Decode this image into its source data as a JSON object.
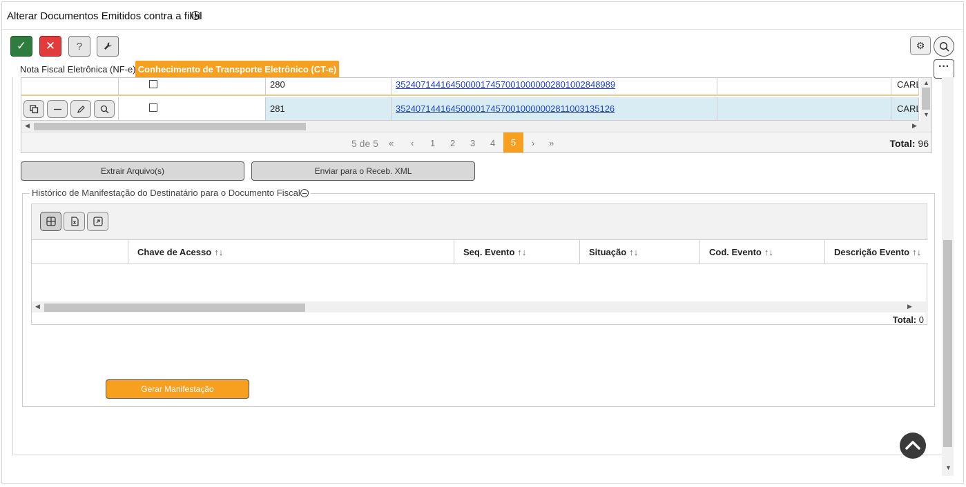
{
  "window": {
    "title": "Alterar Documentos Emitidos contra a filial"
  },
  "toolbar": {
    "confirm_label": "✓",
    "cancel_label": "✕",
    "help_label": "?"
  },
  "tabs": [
    {
      "label": "Nota Fiscal Eletrônica (NF-e)",
      "active": false
    },
    {
      "label": "Conhecimento de Transporte Eletrônico (CT-e)",
      "active": true
    }
  ],
  "documents_grid": {
    "rows": [
      {
        "number": "280",
        "key": "35240714416450000174570010000002801002848989",
        "name": "CARLO"
      },
      {
        "number": "281",
        "key": "35240714416450000174570010000002811003135126",
        "name": "CARLO"
      }
    ],
    "pager": {
      "info": "5 de 5",
      "first": "«",
      "prev": "‹",
      "pages": [
        "1",
        "2",
        "3",
        "4"
      ],
      "current": "5",
      "next": "›",
      "last": "»",
      "total_label": "Total:",
      "total_value": "96"
    }
  },
  "actions": {
    "extract_label": "Extrair Arquivo(s)",
    "send_label": "Enviar para o Receb. XML"
  },
  "history": {
    "legend": "Histórico de Manifestação do Destinatário para o Documento Fiscal",
    "columns": [
      {
        "label": "Chave de Acesso"
      },
      {
        "label": "Seq. Evento"
      },
      {
        "label": "Situação"
      },
      {
        "label": "Cod. Evento"
      },
      {
        "label": "Descrição Evento"
      }
    ],
    "total_label": "Total:",
    "total_value": "0",
    "generate_label": "Gerar Manifestação"
  },
  "colors": {
    "accent": "#f7a01f",
    "confirm": "#2e7d3e",
    "cancel": "#e23b3b",
    "selected_row": "#d9ecf3",
    "link": "#1a3fd6"
  }
}
